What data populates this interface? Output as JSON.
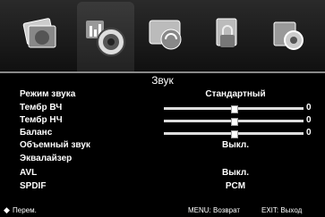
{
  "menu": {
    "title": "Звук",
    "tabs": [
      {
        "name": "picture",
        "icon": "picture-icon",
        "active": false
      },
      {
        "name": "sound",
        "icon": "sound-icon",
        "active": true
      },
      {
        "name": "channel",
        "icon": "channel-icon",
        "active": false
      },
      {
        "name": "lock",
        "icon": "lock-icon",
        "active": false
      },
      {
        "name": "setup",
        "icon": "setup-icon",
        "active": false
      }
    ],
    "items": [
      {
        "label": "Режим звука",
        "value": "Стандартный"
      },
      {
        "label": "Тембр ВЧ",
        "slider": 0.5,
        "number": "0"
      },
      {
        "label": "Тембр НЧ",
        "slider": 0.5,
        "number": "0"
      },
      {
        "label": "Баланс",
        "slider": 0.5,
        "number": "0"
      },
      {
        "label": "Объемный звук",
        "value": "Выкл."
      },
      {
        "label": "Эквалайзер",
        "value": ""
      },
      {
        "label": "AVL",
        "value": "Выкл."
      },
      {
        "label": "SPDIF",
        "value": "PCM"
      }
    ]
  },
  "footer": {
    "move": "Перем.",
    "menu_back": "MENU: Возврат",
    "exit": "EXIT: Выход"
  },
  "colors": {
    "background": "#000000",
    "accent": "#ffffff"
  }
}
